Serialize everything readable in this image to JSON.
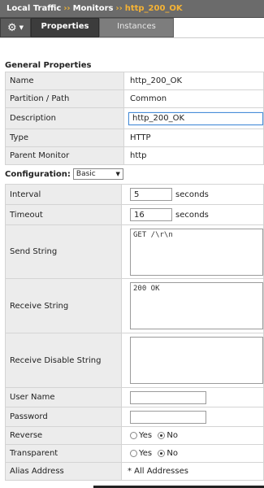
{
  "breadcrumb": {
    "items": [
      "Local Traffic",
      "Monitors"
    ],
    "separator": "››",
    "current": "http_200_OK"
  },
  "tabs": {
    "gear_icon": "gear-icon",
    "items": [
      {
        "label": "Properties",
        "active": true
      },
      {
        "label": "Instances",
        "active": false
      }
    ]
  },
  "general": {
    "heading": "General Properties",
    "name_label": "Name",
    "name_value": "http_200_OK",
    "partition_label": "Partition / Path",
    "partition_value": "Common",
    "description_label": "Description",
    "description_value": "http_200_OK",
    "type_label": "Type",
    "type_value": "HTTP",
    "parent_label": "Parent Monitor",
    "parent_value": "http"
  },
  "configuration": {
    "label": "Configuration:",
    "mode": "Basic",
    "interval_label": "Interval",
    "interval_value": "5",
    "interval_unit": "seconds",
    "timeout_label": "Timeout",
    "timeout_value": "16",
    "timeout_unit": "seconds",
    "send_label": "Send String",
    "send_value": "GET /\\r\\n",
    "receive_label": "Receive String",
    "receive_value": "200 OK",
    "receive_disable_label": "Receive Disable String",
    "receive_disable_value": "",
    "username_label": "User Name",
    "username_value": "",
    "password_label": "Password",
    "password_value": "",
    "reverse_label": "Reverse",
    "reverse_yes": "Yes",
    "reverse_no": "No",
    "transparent_label": "Transparent",
    "transparent_yes": "Yes",
    "transparent_no": "No",
    "alias_label": "Alias Address",
    "alias_value": "* All Addresses"
  }
}
